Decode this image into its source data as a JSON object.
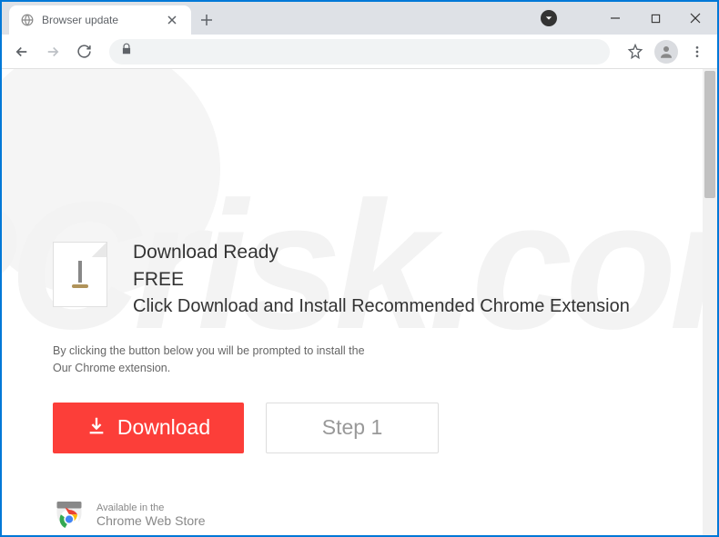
{
  "window": {
    "tab_title": "Browser update"
  },
  "page": {
    "heading": "Download Ready",
    "free_label": "FREE",
    "subheading": "Click Download and Install Recommended Chrome Extension",
    "disclaimer_line1": "By clicking the button below you will be prompted to install the",
    "disclaimer_line2": "Our Chrome extension.",
    "download_button": "Download",
    "step_button": "Step 1",
    "store_available": "Available in the",
    "store_name": "Chrome Web Store"
  },
  "watermark": "PCrisk.com"
}
